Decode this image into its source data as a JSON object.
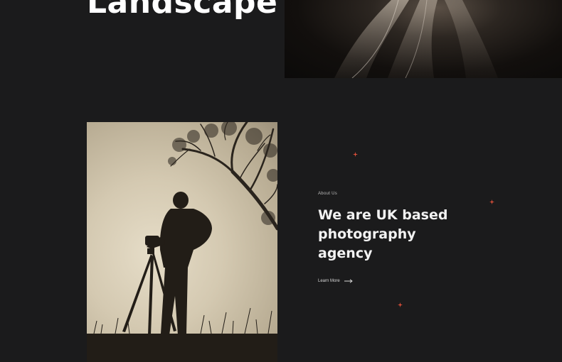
{
  "hero": {
    "title": "Landscape"
  },
  "about": {
    "eyebrow": "About Us",
    "heading_lines": [
      "We are UK based",
      "photography",
      "agency"
    ],
    "cta_label": "Learn More",
    "cta_icon": "arrow-right-icon"
  },
  "decor": {
    "spark_icon": "sparkle-icon",
    "accent_color": "#e0503a"
  },
  "colors": {
    "background": "#1b1b1c",
    "text": "#f2f2f2"
  }
}
